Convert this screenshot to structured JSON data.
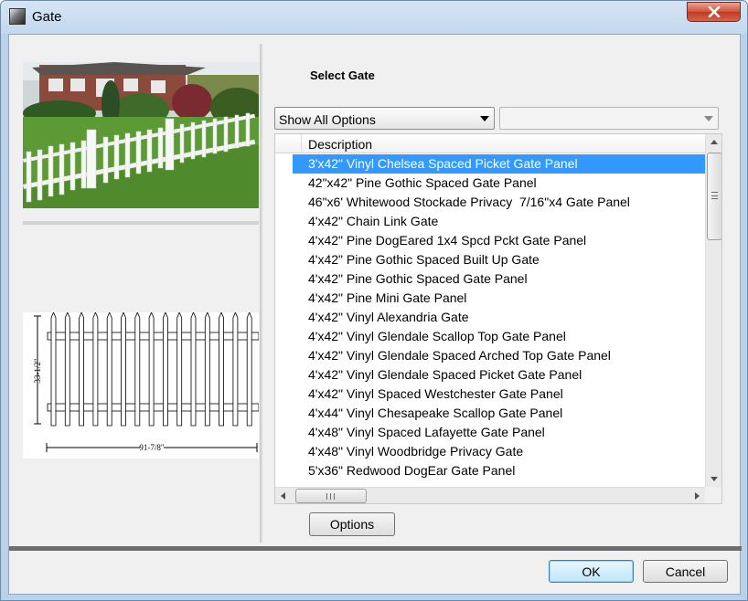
{
  "window": {
    "title": "Gate"
  },
  "panel": {
    "heading": "Select Gate",
    "filter": {
      "selected": "Show All Options",
      "secondary": ""
    }
  },
  "grid": {
    "header": "Description",
    "selected_index": 0,
    "rows": [
      "3'x42\" Vinyl Chelsea Spaced Picket Gate Panel",
      "42\"x42\" Pine Gothic Spaced Gate Panel",
      "46\"x6' Whitewood Stockade Privacy  7/16\"x4 Gate Panel",
      "4'x42\" Chain Link Gate",
      "4'x42\" Pine DogEared 1x4 Spcd Pckt Gate Panel",
      "4'x42\" Pine Gothic Spaced Built Up Gate",
      "4'x42\" Pine Gothic Spaced Gate Panel",
      "4'x42\" Pine Mini Gate Panel",
      "4'x42\" Vinyl Alexandria Gate",
      "4'x42\" Vinyl Glendale Scallop Top Gate Panel",
      "4'x42\" Vinyl Glendale Spaced Arched Top Gate Panel",
      "4'x42\" Vinyl Glendale Spaced Picket Gate Panel",
      "4'x42\" Vinyl Spaced Westchester Gate Panel",
      "4'x44\" Vinyl Chesapeake Scallop Gate Panel",
      "4'x48\" Vinyl Spaced Lafayette Gate Panel",
      "4'x48\" Vinyl Woodbridge Privacy Gate",
      "5'x36\" Redwood DogEar Gate Panel"
    ]
  },
  "drawing": {
    "height_label": "33-1/2\"",
    "width_label": "91-7/8\""
  },
  "buttons": {
    "options": "Options",
    "ok": "OK",
    "cancel": "Cancel"
  },
  "icons": {
    "app": "gate-app-icon",
    "close": "close-icon",
    "dropdown": "chevron-down-icon",
    "scroll_up": "arrow-up-icon",
    "scroll_down": "arrow-down-icon",
    "scroll_left": "arrow-left-icon",
    "scroll_right": "arrow-right-icon"
  },
  "colors": {
    "selection": "#3399ff",
    "close_button": "#c9462c",
    "title_bar": "#c9dcf0"
  }
}
